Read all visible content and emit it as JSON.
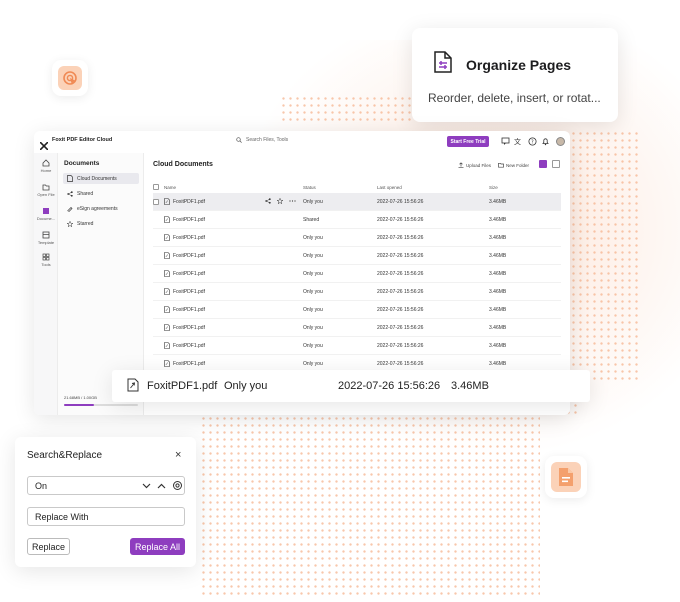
{
  "colors": {
    "brand": "#8e3dbf",
    "accent_peach": "#f6b48f"
  },
  "organize_card": {
    "title": "Organize Pages",
    "subtitle": "Reorder, delete, insert, or rotat..."
  },
  "app": {
    "title": "Foxit PDF Editor Cloud",
    "search_placeholder": "Search Files, Tools",
    "trial_button": "Start Free Trial",
    "rail": [
      {
        "icon": "home-icon",
        "label": "Home"
      },
      {
        "icon": "open-file-icon",
        "label": "Open File"
      },
      {
        "icon": "documents-icon",
        "label": "Docume..."
      },
      {
        "icon": "template-icon",
        "label": "Template"
      },
      {
        "icon": "tools-icon",
        "label": "Tools"
      }
    ],
    "panel": {
      "title": "Documents",
      "items": [
        {
          "icon": "cloud-document-icon",
          "label": "Cloud Documents"
        },
        {
          "icon": "share-icon",
          "label": "Shared"
        },
        {
          "icon": "esign-icon",
          "label": "eSign agreements"
        },
        {
          "icon": "star-icon",
          "label": "Starred"
        }
      ],
      "storage": "21.68MB / 1.00GB",
      "storage_fraction": 0.4
    },
    "main": {
      "title": "Cloud Documents",
      "upload_label": "Upload Files",
      "new_folder_label": "New Folder",
      "columns": [
        "Name",
        "Status",
        "Last opened",
        "Size"
      ],
      "rows": [
        {
          "name": "FoxitPDF1.pdf",
          "status": "Only you",
          "date": "2022-07-26 15:56:26",
          "size": "3.46MB"
        },
        {
          "name": "FoxitPDF1.pdf",
          "status": "Shared",
          "date": "2022-07-26 15:56:26",
          "size": "3.46MB"
        },
        {
          "name": "FoxitPDF1.pdf",
          "status": "Only you",
          "date": "2022-07-26 15:56:26",
          "size": "3.46MB"
        },
        {
          "name": "FoxitPDF1.pdf",
          "status": "Only you",
          "date": "2022-07-26 15:56:26",
          "size": "3.46MB"
        },
        {
          "name": "FoxitPDF1.pdf",
          "status": "Only you",
          "date": "2022-07-26 15:56:26",
          "size": "3.46MB"
        },
        {
          "name": "FoxitPDF1.pdf",
          "status": "Only you",
          "date": "2022-07-26 15:56:26",
          "size": "3.46MB"
        },
        {
          "name": "FoxitPDF1.pdf",
          "status": "Only you",
          "date": "2022-07-26 15:56:26",
          "size": "3.46MB"
        },
        {
          "name": "FoxitPDF1.pdf",
          "status": "Only you",
          "date": "2022-07-26 15:56:26",
          "size": "3.46MB"
        },
        {
          "name": "FoxitPDF1.pdf",
          "status": "Only you",
          "date": "2022-07-26 15:56:26",
          "size": "3.46MB"
        },
        {
          "name": "FoxitPDF1.pdf",
          "status": "Only you",
          "date": "2022-07-26 15:56:26",
          "size": "3.46MB"
        }
      ]
    }
  },
  "row_card": {
    "name": "FoxitPDF1.pdf",
    "status": "Only you",
    "date": "2022-07-26 15:56:26",
    "size": "3.46MB"
  },
  "search_replace": {
    "title": "Search&Replace",
    "close": "×",
    "search_value": "On",
    "replace_placeholder": "Replace With",
    "replace_button": "Replace",
    "replace_all_button": "Replace All"
  }
}
